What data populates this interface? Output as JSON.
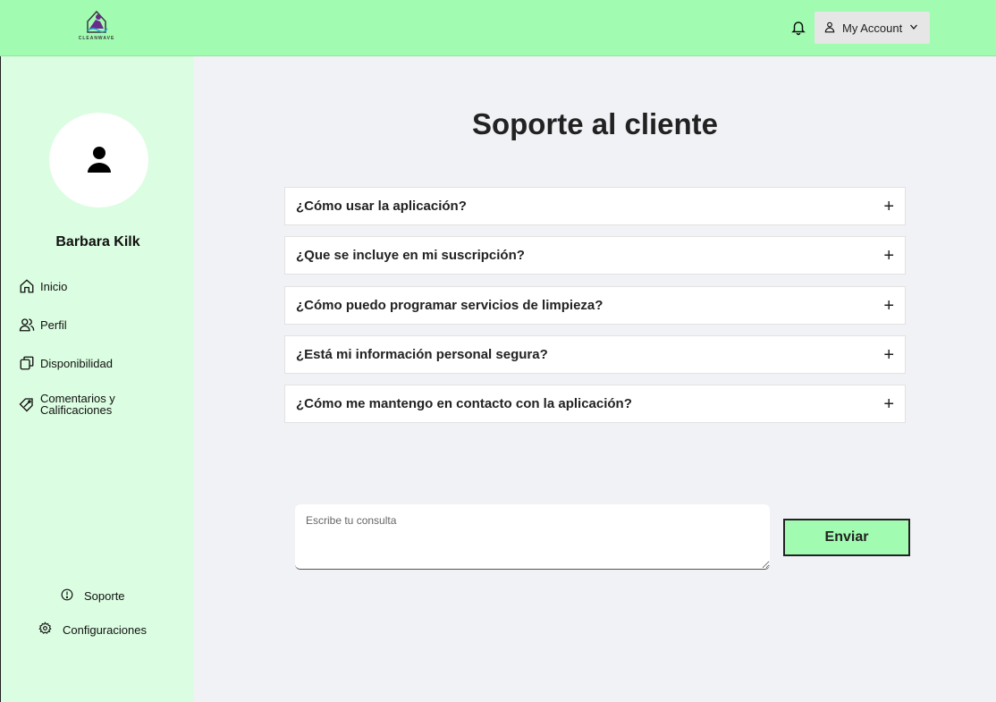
{
  "header": {
    "logo_text": "CLEANWAVE",
    "account_label": "My Account",
    "accent_color": "#a1fcb1"
  },
  "sidebar": {
    "user_name": "Barbara Kilk",
    "items": [
      {
        "label": "Inicio",
        "icon": "home-icon"
      },
      {
        "label": "Perfil",
        "icon": "users-icon"
      },
      {
        "label": "Disponibilidad",
        "icon": "copy-icon"
      },
      {
        "label": "Comentarios y Calificaciones",
        "icon": "tag-icon"
      }
    ],
    "bottom_items": [
      {
        "label": "Soporte",
        "icon": "info-icon"
      },
      {
        "label": "Configuraciones",
        "icon": "gear-icon"
      }
    ],
    "background_color": "#dbfde1"
  },
  "main": {
    "title": "Soporte al cliente",
    "faqs": [
      "¿Cómo usar la aplicación?",
      "¿Que se incluye en mi suscripción?",
      "¿Cómo puedo programar servicios de limpieza?",
      "¿Está mi información personal segura?",
      "¿Cómo me mantengo en contacto con la aplicación?"
    ],
    "query_placeholder": "Escribe tu consulta",
    "send_label": "Enviar"
  }
}
